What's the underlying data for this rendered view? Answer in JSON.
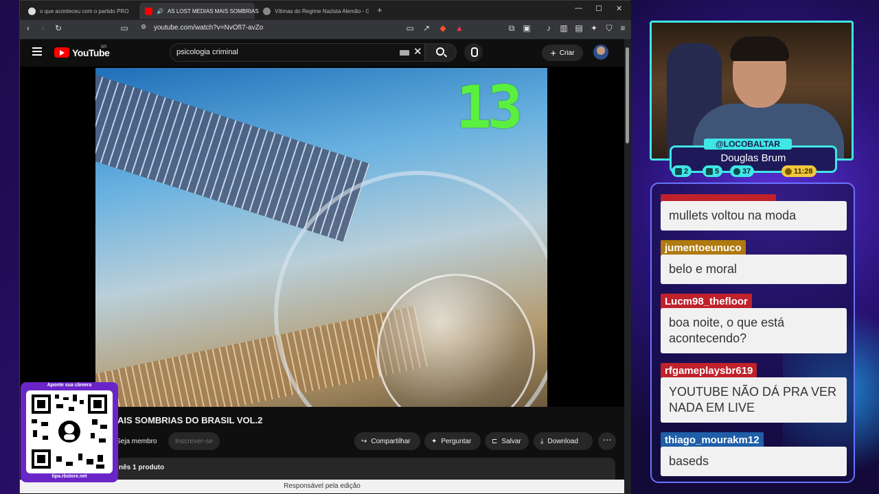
{
  "browser": {
    "tabs": [
      {
        "label": "o que aconteceu com o partido PRONA - Pe",
        "active": false
      },
      {
        "label": "AS LOST MEDIAS MAIS SOMBRIAS",
        "active": true
      },
      {
        "label": "Vítimas do Regime Nazista Alemão - Grok",
        "active": false
      }
    ],
    "url": "youtube.com/watch?v=NvOfI7-avZo",
    "status_bar": "Responsável pela edição"
  },
  "youtube": {
    "logo": "YouTube",
    "country": "BR",
    "search_value": "psicologia criminal",
    "create_label": "Criar",
    "video_overlay_number": "13",
    "title": "AIS SOMBRIAS DO BRASIL VOL.2",
    "actions": {
      "join": "Seja membro",
      "subscribe": "Inscrever-se",
      "share": "Compartilhar",
      "ask": "Perguntar",
      "save": "Salvar",
      "download": "Download"
    },
    "description_snippet": "nês   1 produto"
  },
  "qr_overlay": {
    "caption": "Aponte sua câmera",
    "url": "tipa.rbstore.net"
  },
  "stream": {
    "handle": "@LOCOBALTAR",
    "name": "Douglas Brum",
    "stats": [
      {
        "icon": "chat-icon",
        "value": "2"
      },
      {
        "icon": "play-icon",
        "value": "5"
      },
      {
        "icon": "user-icon",
        "value": "37"
      },
      {
        "icon": "clock-icon",
        "value": "11:28"
      }
    ]
  },
  "chat": [
    {
      "user": "",
      "message": "mullets voltou na moda",
      "color": "#c0212b"
    },
    {
      "user": "jumentoeunuco",
      "message": "belo e moral",
      "color": "#b07a10"
    },
    {
      "user": "Lucm98_thefloor",
      "message": "boa noite, o que está acontecendo?",
      "color": "#c0212b"
    },
    {
      "user": "rfgameplaysbr619",
      "message": "YOUTUBE NÃO DÁ PRA VER NADA EM LIVE",
      "color": "#c0212b"
    },
    {
      "user": "thiago_mourakm12",
      "message": "baseds",
      "color": "#1f5fa8"
    }
  ],
  "colors": {
    "accent_cyan": "#3fe6e6",
    "youtube_red": "#ff0000",
    "countdown_green": "#5bf040"
  }
}
